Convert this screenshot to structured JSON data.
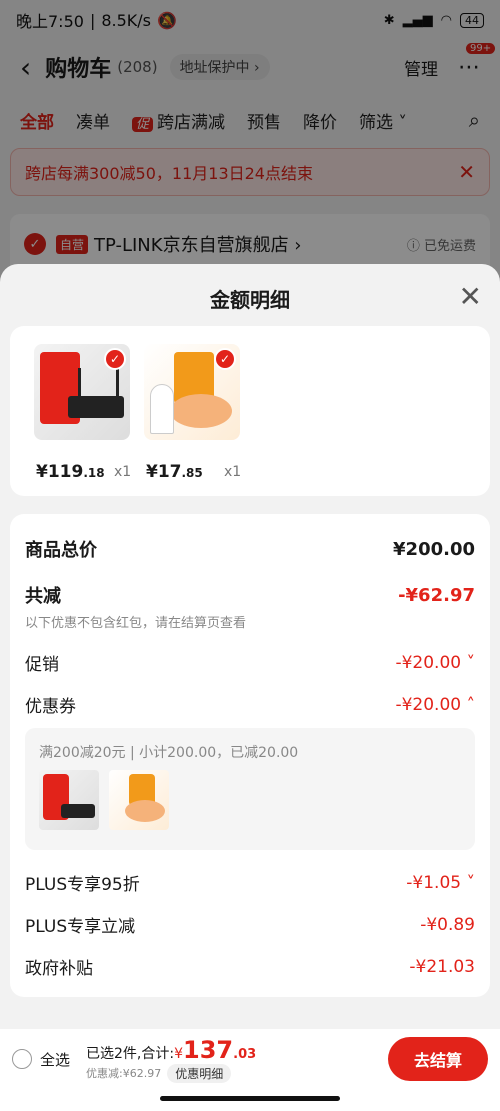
{
  "status_bar": {
    "time": "晚上7:50",
    "speed": "8.5K/s",
    "battery": "44"
  },
  "nav": {
    "title": "购物车",
    "count": "(208)",
    "address": "地址保护中 ›",
    "manage": "管理",
    "badge": "99+"
  },
  "tabs": [
    {
      "label": "全部",
      "active": true
    },
    {
      "label": "凑单"
    },
    {
      "label": "跨店满减",
      "tag": "促"
    },
    {
      "label": "预售"
    },
    {
      "label": "降价"
    },
    {
      "label": "筛选 ˅"
    }
  ],
  "notice": {
    "text": "跨店每满300减50，11月13日24点结束"
  },
  "store": {
    "self_tag": "自营",
    "name": "TP-LINK京东自营旗舰店 ›",
    "shipping": "ⓘ 已免运费"
  },
  "sheet": {
    "title": "金额明细",
    "products": [
      {
        "price_main": "¥119",
        "price_cents": ".18",
        "qty": "x1"
      },
      {
        "price_main": "¥17",
        "price_cents": ".85",
        "qty": "x1"
      }
    ],
    "total_label": "商品总价",
    "total_value": "¥200.00",
    "reduce_label": "共减",
    "reduce_value": "-¥62.97",
    "reduce_hint": "以下优惠不包含红包，请在结算页查看",
    "promo_label": "促销",
    "promo_value": "-¥20.00 ˅",
    "coupon_label": "优惠券",
    "coupon_value": "-¥20.00 ˄",
    "coupon_detail": "满200减20元 | 小计200.00，已减20.00",
    "plus95_label": "PLUS专享95折",
    "plus95_value": "-¥1.05 ˅",
    "plusreduce_label": "PLUS专享立减",
    "plusreduce_value": "-¥0.89",
    "gov_label": "政府补贴",
    "gov_value": "-¥21.03"
  },
  "bottom": {
    "select_all": "全选",
    "selected": "已选2件,合计:",
    "currency": "¥",
    "total_main": "137",
    "total_cents": ".03",
    "saved": "优惠减:¥62.97",
    "detail_pill": "优惠明细",
    "checkout": "去结算"
  },
  "colors": {
    "accent": "#e2231a"
  }
}
